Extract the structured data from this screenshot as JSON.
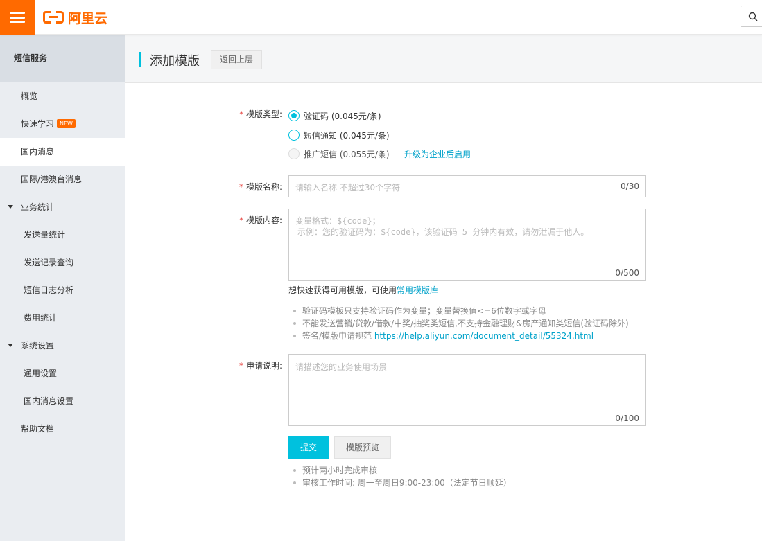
{
  "colors": {
    "accent": "#ff6a00",
    "primary": "#00c1de",
    "link": "#00a2ca",
    "required": "#e53935"
  },
  "header": {
    "brand": "阿里云",
    "menu_icon": "hamburger-menu-icon",
    "search_icon": "search-icon"
  },
  "sidebar": {
    "title": "短信服务",
    "items": [
      {
        "label": "概览"
      },
      {
        "label": "快速学习",
        "badge": "NEW"
      },
      {
        "label": "国内消息"
      },
      {
        "label": "国际/港澳台消息"
      },
      {
        "label": "业务统计"
      },
      {
        "label": "发送量统计"
      },
      {
        "label": "发送记录查询"
      },
      {
        "label": "短信日志分析"
      },
      {
        "label": "费用统计"
      },
      {
        "label": "系统设置"
      },
      {
        "label": "通用设置"
      },
      {
        "label": "国内消息设置"
      },
      {
        "label": "帮助文档"
      }
    ]
  },
  "page": {
    "title": "添加模版",
    "back_label": "返回上层"
  },
  "form": {
    "type": {
      "label": "模版类型:",
      "options": [
        {
          "label": "验证码 (0.045元/条)",
          "checked": true
        },
        {
          "label": "短信通知 (0.045元/条)",
          "checked": false
        },
        {
          "label": "推广短信 (0.055元/条)",
          "disabled": true
        }
      ],
      "upgrade_link": "升级为企业后启用"
    },
    "name": {
      "label": "模版名称:",
      "placeholder": "请输入名称 不超过30个字符",
      "count": "0/30"
    },
    "content": {
      "label": "模版内容:",
      "placeholder_line1": "变量格式：${code}；",
      "placeholder_line2": "示例：您的验证码为：${code}，该验证码 5 分钟内有效，请勿泄漏于他人。",
      "count": "0/500",
      "hint_prefix": "想快速获得可用模版，可使用",
      "hint_link": "常用模版库",
      "rules": [
        "验证码模板只支持验证码作为变量；变量替换值<=6位数字或字母",
        "不能发送营销/贷款/借款/中奖/抽奖类短信,不支持金融理财&房产通知类短信(验证码除外)"
      ],
      "spec_prefix": "签名/模版申请规范 ",
      "spec_link": "https://help.aliyun.com/document_detail/55324.html"
    },
    "description": {
      "label": "申请说明:",
      "placeholder": "请描述您的业务使用场景",
      "count": "0/100"
    },
    "required_mark": "*",
    "submit_label": "提交",
    "preview_label": "模版预览",
    "notes": [
      "预计两小时完成审核",
      "审核工作时间: 周一至周日9:00-23:00（法定节日顺延）"
    ]
  }
}
